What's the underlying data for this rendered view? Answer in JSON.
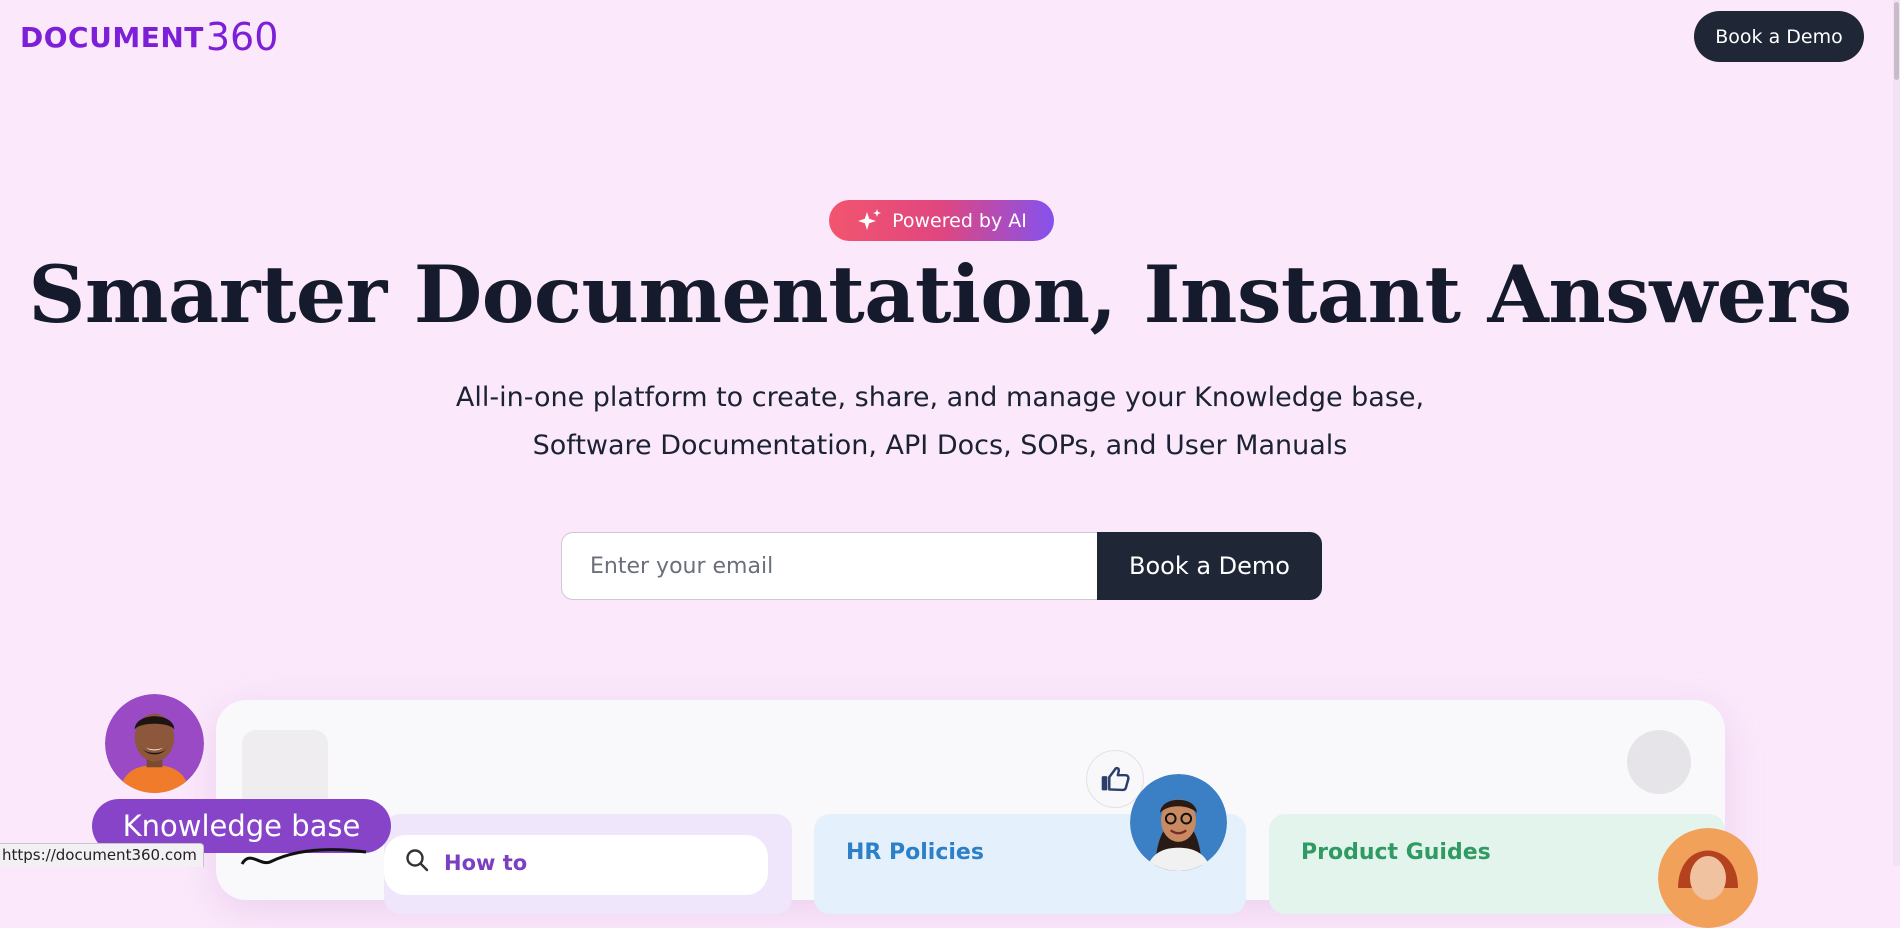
{
  "header": {
    "logo_text": "DOCUMENT",
    "logo_number": "360",
    "demo_button": "Book a Demo"
  },
  "hero": {
    "badge": "Powered by AI",
    "title": "Smarter Documentation, Instant Answers",
    "subtitle_line1": "All-in-one platform to create, share, and manage your Knowledge base,",
    "subtitle_line2": "Software Documentation, API Docs, SOPs, and User Manuals",
    "email_placeholder": "Enter your email",
    "form_button": "Book a Demo"
  },
  "preview": {
    "kb_pill": "Knowledge base",
    "search_text": "How to",
    "cards": [
      {
        "title": ""
      },
      {
        "title": "HR Policies"
      },
      {
        "title": "Product Guides"
      }
    ]
  },
  "status_bar": {
    "url": "https://document360.com"
  },
  "colors": {
    "brand": "#7d1fd6",
    "background": "#fbe9fb",
    "dark_button": "#1f2636"
  }
}
